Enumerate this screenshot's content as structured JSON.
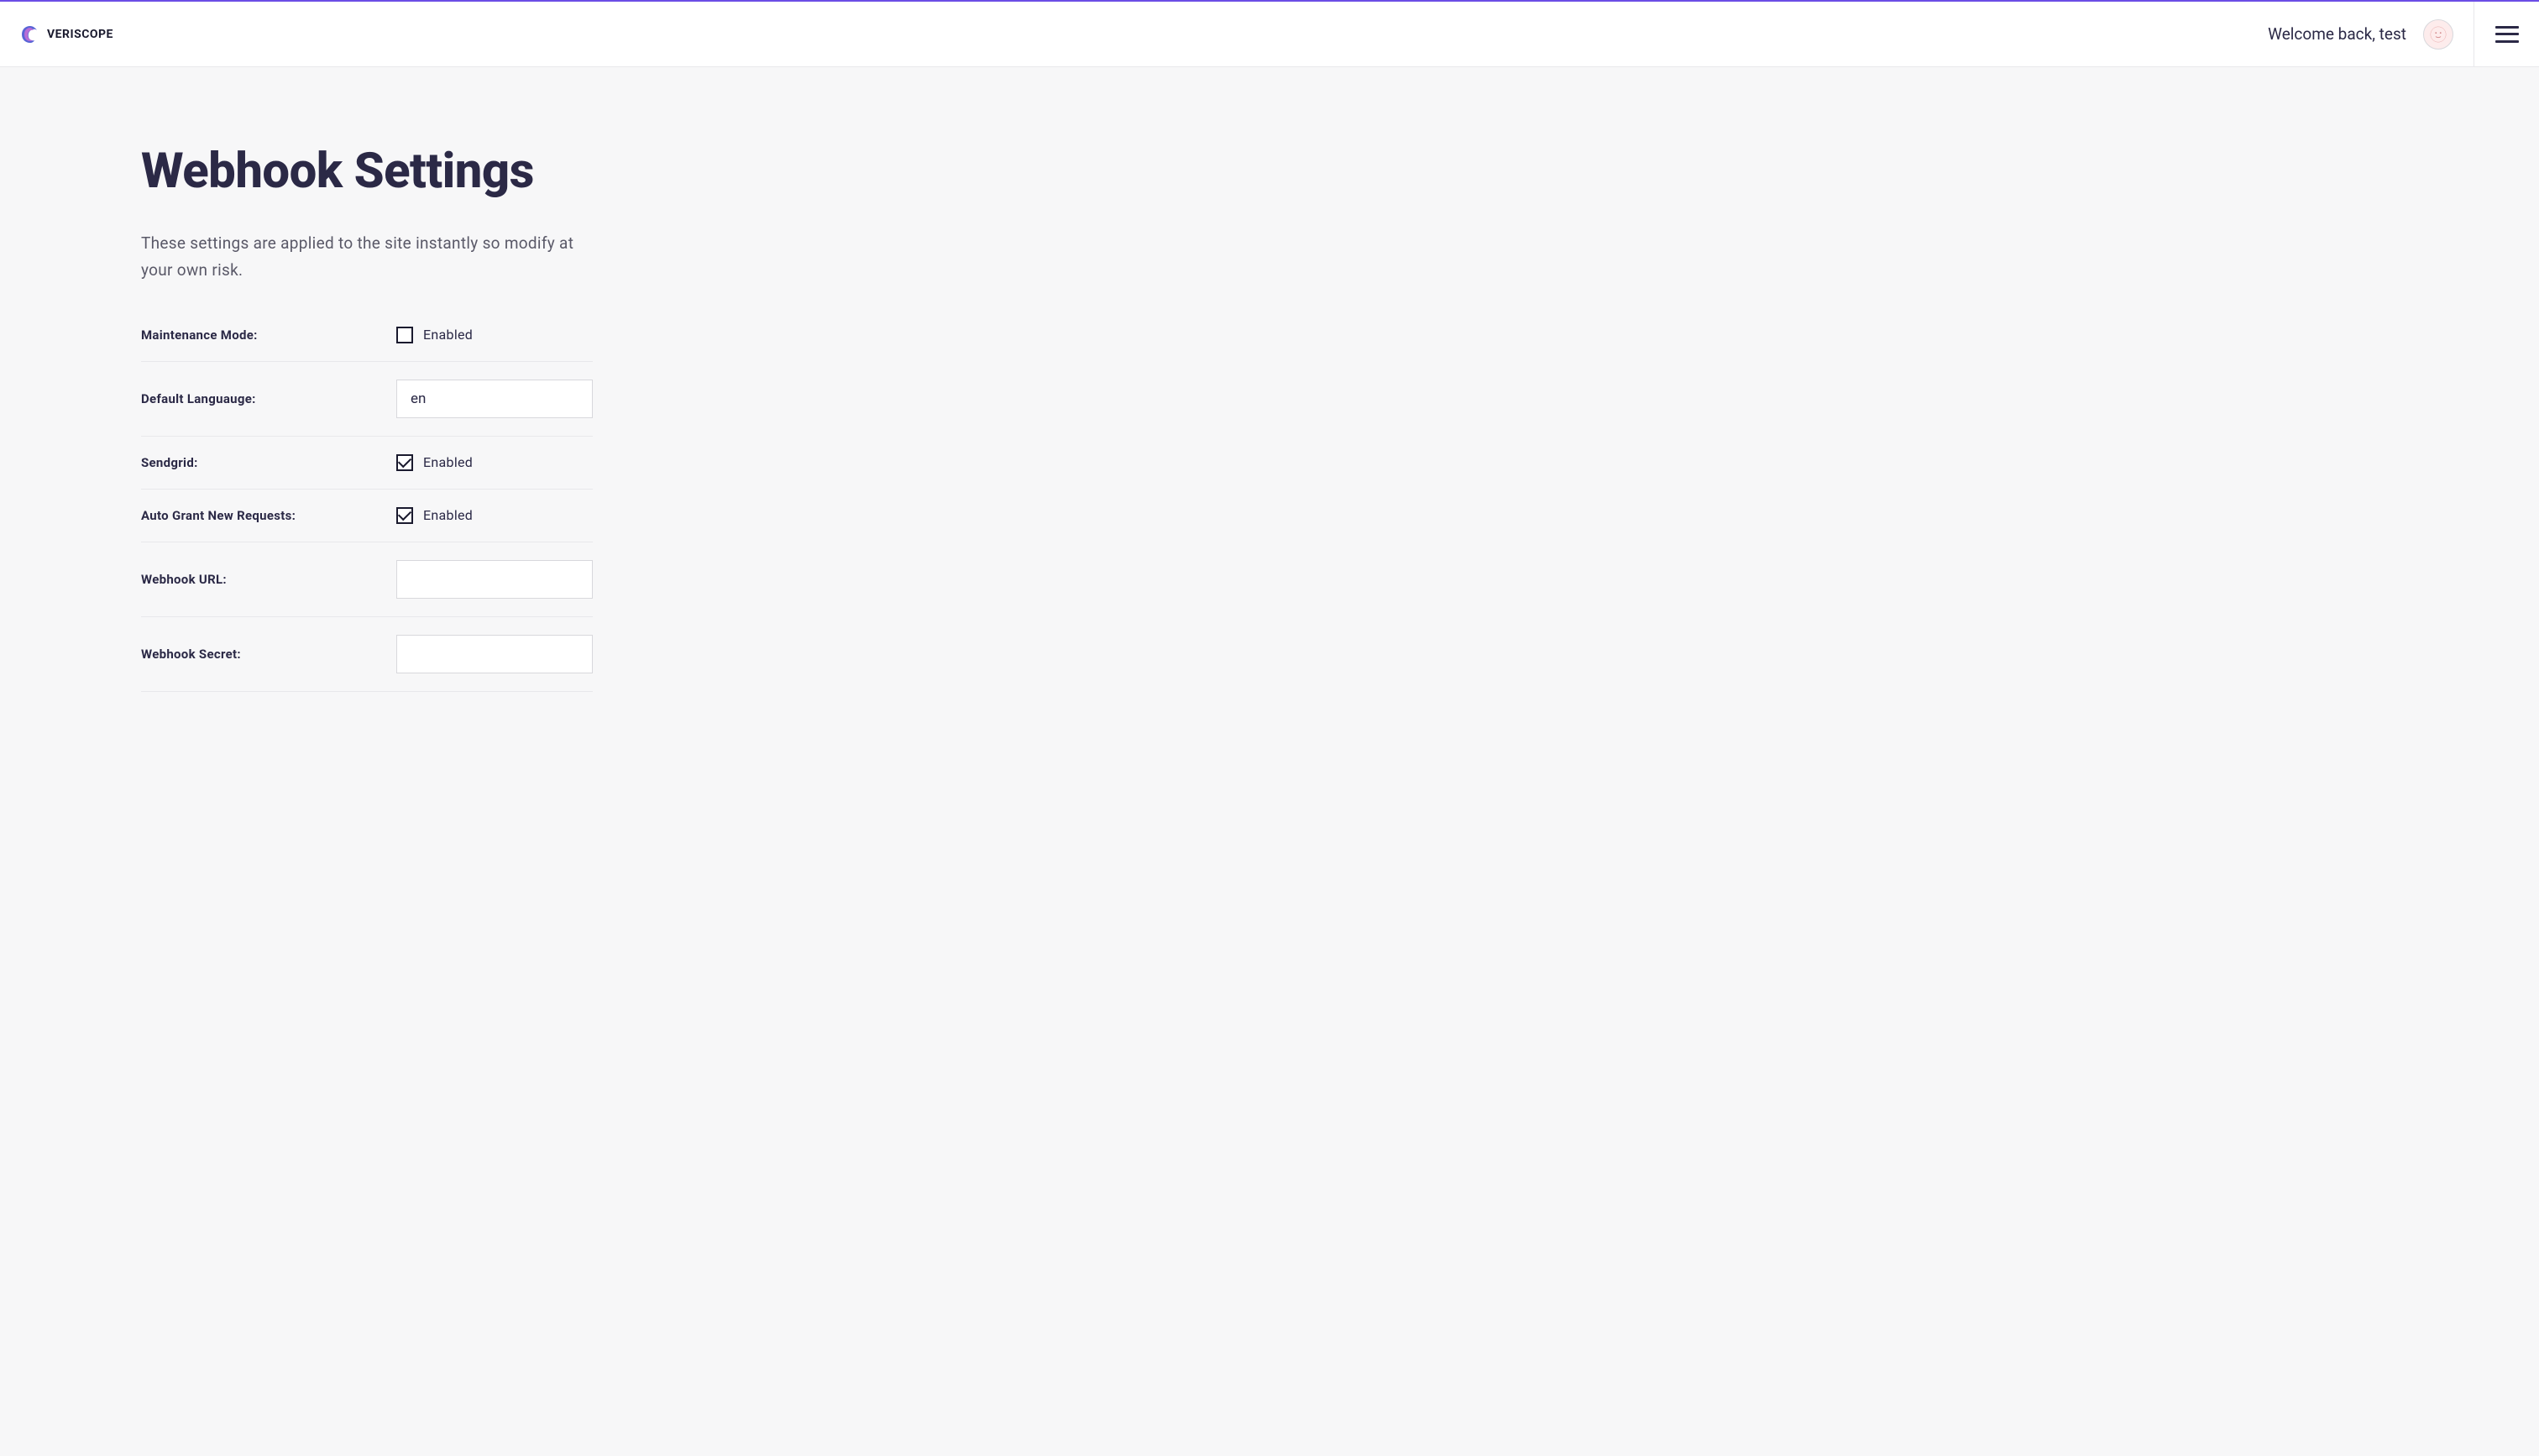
{
  "brand": {
    "name": "VERISCOPE"
  },
  "header": {
    "welcome_text": "Welcome back, test"
  },
  "page": {
    "title": "Webhook Settings",
    "description": "These settings are applied to the site instantly so modify at your own risk."
  },
  "form": {
    "maintenance_mode": {
      "label": "Maintenance Mode:",
      "checkbox_label": "Enabled",
      "checked": false
    },
    "default_language": {
      "label": "Default Languauge:",
      "value": "en"
    },
    "sendgrid": {
      "label": "Sendgrid:",
      "checkbox_label": "Enabled",
      "checked": true
    },
    "auto_grant": {
      "label": "Auto Grant New Requests:",
      "checkbox_label": "Enabled",
      "checked": true
    },
    "webhook_url": {
      "label": "Webhook URL:",
      "value": ""
    },
    "webhook_secret": {
      "label": "Webhook Secret:",
      "value": ""
    }
  }
}
